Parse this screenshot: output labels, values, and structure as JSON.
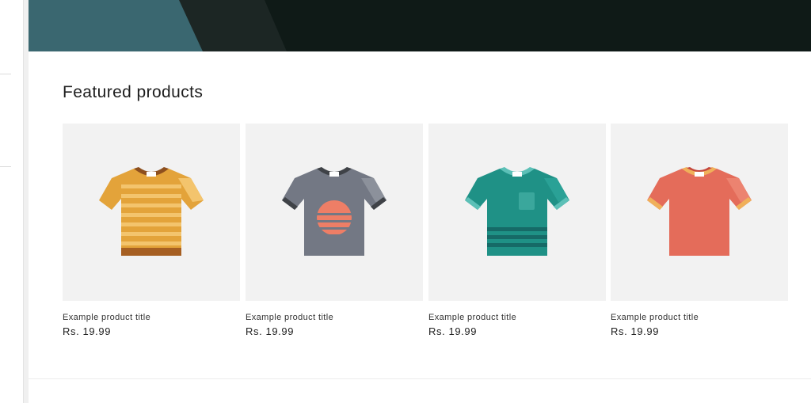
{
  "section": {
    "title": "Featured products"
  },
  "products": [
    {
      "title": "Example product title",
      "price": "Rs. 19.99",
      "image": "striped-orange-tshirt-icon",
      "colors": {
        "body": "#e3a33a",
        "stripe": "#f3c46d",
        "collar": "#8d4f1e"
      }
    },
    {
      "title": "Example product title",
      "price": "Rs. 19.99",
      "image": "gray-sunset-tshirt-icon",
      "colors": {
        "body": "#737884",
        "stripe": "#ee7e66",
        "collar": "#3f4247"
      }
    },
    {
      "title": "Example product title",
      "price": "Rs. 19.99",
      "image": "teal-pocket-tshirt-icon",
      "colors": {
        "body": "#1f9186",
        "stripe": "#166a67",
        "collar": "#5cc0b7"
      }
    },
    {
      "title": "Example product title",
      "price": "Rs. 19.99",
      "image": "coral-tshirt-icon",
      "colors": {
        "body": "#e46c5a",
        "stripe": "#f0b05a",
        "collar": "#c4463c"
      }
    }
  ],
  "colors": {
    "hero_dark": "#0f1a17",
    "hero_teal": "#3a6770",
    "card_bg": "#f2f2f2"
  }
}
